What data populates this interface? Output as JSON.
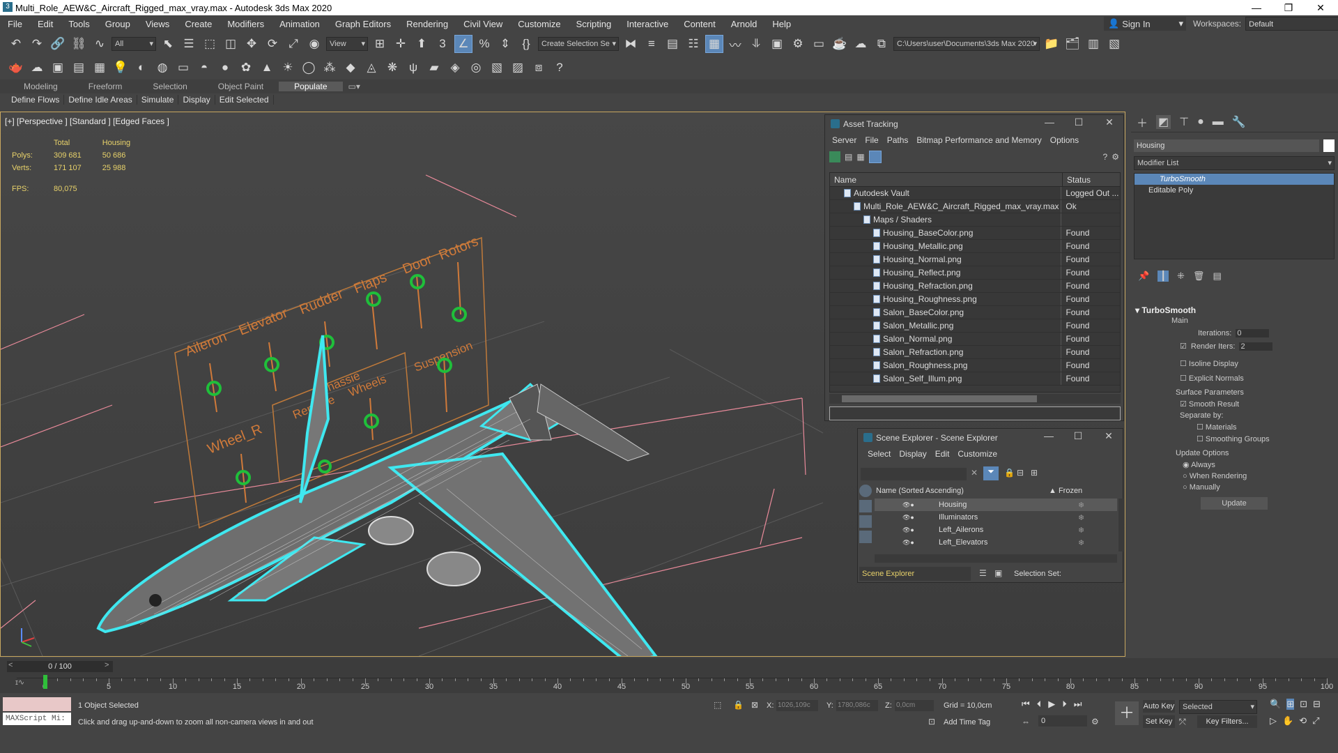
{
  "title": "Multi_Role_AEW&C_Aircraft_Rigged_max_vray.max - Autodesk 3ds Max 2020",
  "menu": [
    "File",
    "Edit",
    "Tools",
    "Group",
    "Views",
    "Create",
    "Modifiers",
    "Animation",
    "Graph Editors",
    "Rendering",
    "Civil View",
    "Customize",
    "Scripting",
    "Interactive",
    "Content",
    "Arnold",
    "Help"
  ],
  "signin": "Sign In",
  "workspaces_label": "Workspaces:",
  "workspace": "Default",
  "toolbar": {
    "filter": "All",
    "view": "View",
    "selection_set": "Create Selection Se",
    "path": "C:\\Users\\user\\Documents\\3ds Max 2020"
  },
  "ribbon": {
    "tabs": [
      "Modeling",
      "Freeform",
      "Selection",
      "Object Paint",
      "Populate"
    ],
    "sub": [
      "Define Flows",
      "Define Idle Areas",
      "Simulate",
      "Display",
      "Edit Selected"
    ]
  },
  "viewport": {
    "label": "[+] [Perspective ] [Standard ] [Edged Faces ]",
    "stats": {
      "h_total": "Total",
      "h_housing": "Housing",
      "polys_label": "Polys:",
      "polys_total": "309 681",
      "polys_housing": "50 686",
      "verts_label": "Verts:",
      "verts_total": "171 107",
      "verts_housing": "25 988",
      "fps_label": "FPS:",
      "fps": "80,075"
    },
    "rig_labels": [
      "Aileron",
      "Elevator",
      "Rudder",
      "Flaps",
      "Door",
      "Rotors",
      "Suspension",
      "Chassie",
      "Remove",
      "Wheels",
      "Wheel_R"
    ]
  },
  "asset_tracking": {
    "title": "Asset Tracking",
    "menu": [
      "Server",
      "File",
      "Paths",
      "Bitmap Performance and Memory",
      "Options"
    ],
    "col_name": "Name",
    "col_status": "Status",
    "rows": [
      {
        "name": "Autodesk Vault",
        "status": "Logged Out ...",
        "indent": 1
      },
      {
        "name": "Multi_Role_AEW&C_Aircraft_Rigged_max_vray.max",
        "status": "Ok",
        "indent": 2
      },
      {
        "name": "Maps / Shaders",
        "status": "",
        "indent": 3
      },
      {
        "name": "Housing_BaseColor.png",
        "status": "Found",
        "indent": 4
      },
      {
        "name": "Housing_Metallic.png",
        "status": "Found",
        "indent": 4
      },
      {
        "name": "Housing_Normal.png",
        "status": "Found",
        "indent": 4
      },
      {
        "name": "Housing_Reflect.png",
        "status": "Found",
        "indent": 4
      },
      {
        "name": "Housing_Refraction.png",
        "status": "Found",
        "indent": 4
      },
      {
        "name": "Housing_Roughness.png",
        "status": "Found",
        "indent": 4
      },
      {
        "name": "Salon_BaseColor.png",
        "status": "Found",
        "indent": 4
      },
      {
        "name": "Salon_Metallic.png",
        "status": "Found",
        "indent": 4
      },
      {
        "name": "Salon_Normal.png",
        "status": "Found",
        "indent": 4
      },
      {
        "name": "Salon_Refraction.png",
        "status": "Found",
        "indent": 4
      },
      {
        "name": "Salon_Roughness.png",
        "status": "Found",
        "indent": 4
      },
      {
        "name": "Salon_Self_Illum.png",
        "status": "Found",
        "indent": 4
      }
    ]
  },
  "scene_explorer": {
    "title": "Scene Explorer - Scene Explorer",
    "menu": [
      "Select",
      "Display",
      "Edit",
      "Customize"
    ],
    "col_name": "Name (Sorted Ascending)",
    "col_frozen": "▲ Frozen",
    "items": [
      "Housing",
      "Illuminators",
      "Left_Ailerons",
      "Left_Elevators"
    ],
    "footer": "Scene Explorer",
    "selection_set": "Selection Set:"
  },
  "command_panel": {
    "object_name": "Housing",
    "modifier_list": "Modifier List",
    "stack": [
      "TurboSmooth",
      "Editable Poly"
    ],
    "rollout": "TurboSmooth",
    "main": "Main",
    "iterations_label": "Iterations:",
    "iterations": "0",
    "render_iters_label": "Render Iters:",
    "render_iters": "2",
    "isoline": "Isoline Display",
    "explicit": "Explicit Normals",
    "surface": "Surface Parameters",
    "smooth_result": "Smooth Result",
    "separate": "Separate by:",
    "materials": "Materials",
    "smoothing": "Smoothing Groups",
    "update_opts": "Update Options",
    "always": "Always",
    "when_rendering": "When Rendering",
    "manually": "Manually",
    "update": "Update"
  },
  "timeline": {
    "frame": "0 / 100",
    "ticks": [
      "0",
      "5",
      "10",
      "15",
      "20",
      "25",
      "30",
      "35",
      "40",
      "45",
      "50",
      "55",
      "60",
      "65",
      "70",
      "75",
      "80",
      "85",
      "90",
      "95",
      "100"
    ]
  },
  "status": {
    "maxscript": "MAXScript Mi:",
    "selected": "1 Object Selected",
    "hint": "Click and drag up-and-down to zoom all non-camera views in and out",
    "x_label": "X:",
    "x": "1026,109c",
    "y_label": "Y:",
    "y": "1780,086c",
    "z_label": "Z:",
    "z": "0,0cm",
    "grid": "Grid = 10,0cm",
    "add_time_tag": "Add Time Tag",
    "auto_key": "Auto Key",
    "set_key": "Set Key",
    "key_mode": "Selected",
    "key_filters": "Key Filters...",
    "frame_field": "0"
  }
}
